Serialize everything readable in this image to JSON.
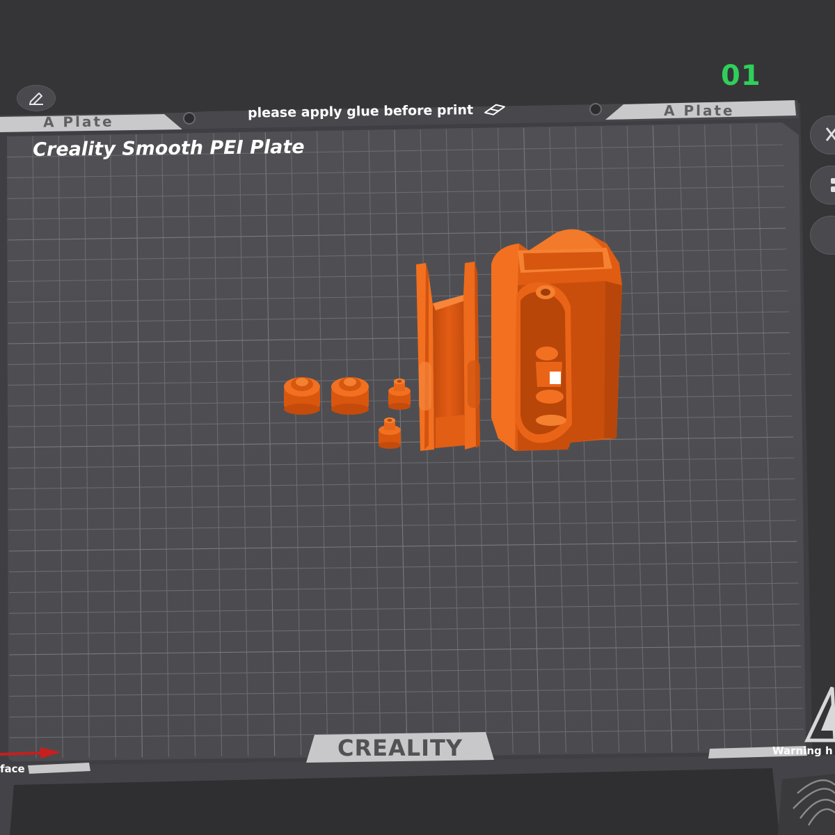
{
  "plate": {
    "number": "01",
    "brand_label": "Creality Smooth PEI Plate",
    "notice": "please apply glue before print",
    "tab_left": "A Plate",
    "tab_right": "A Plate",
    "logo_text": "CREALITY",
    "warning_text": "Warning h",
    "face_label": "face"
  },
  "colors": {
    "background": "#353538",
    "bed": "#4e4e52",
    "grid_line": "#6e6e72",
    "model": "#f06418",
    "plate_number": "#2fd05a",
    "axis_x": "#c81e1e"
  },
  "icons": {
    "edit": "pencil-icon",
    "notice": "eraser-icon",
    "warning": "warning-triangle-icon",
    "fingerprint": "fingerprint-icon"
  }
}
